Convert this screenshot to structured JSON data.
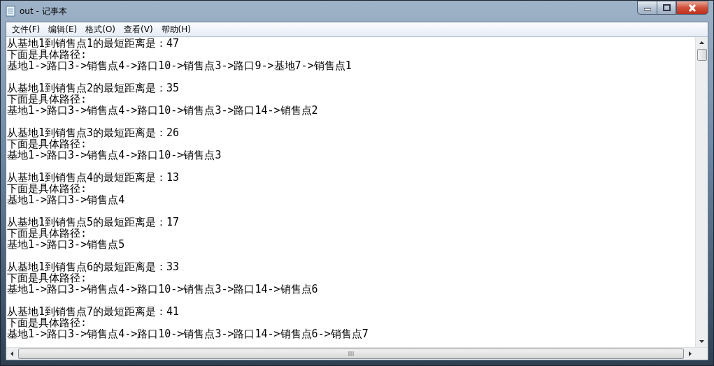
{
  "window": {
    "title": "out - 记事本"
  },
  "menu": [
    "文件(F)",
    "编辑(E)",
    "格式(O)",
    "查看(V)",
    "帮助(H)"
  ],
  "blocks": [
    {
      "heading": "从基地1到销售点1的最短距离是：47",
      "subheading": "下面是具体路径:",
      "path": "基地1->路口3->销售点4->路口10->销售点3->路口9->基地7->销售点1"
    },
    {
      "heading": "从基地1到销售点2的最短距离是：35",
      "subheading": "下面是具体路径:",
      "path": "基地1->路口3->销售点4->路口10->销售点3->路口14->销售点2"
    },
    {
      "heading": "从基地1到销售点3的最短距离是：26",
      "subheading": "下面是具体路径:",
      "path": "基地1->路口3->销售点4->路口10->销售点3"
    },
    {
      "heading": "从基地1到销售点4的最短距离是：13",
      "subheading": "下面是具体路径:",
      "path": "基地1->路口3->销售点4"
    },
    {
      "heading": "从基地1到销售点5的最短距离是：17",
      "subheading": "下面是具体路径:",
      "path": "基地1->路口3->销售点5"
    },
    {
      "heading": "从基地1到销售点6的最短距离是：33",
      "subheading": "下面是具体路径:",
      "path": "基地1->路口3->销售点4->路口10->销售点3->路口14->销售点6"
    },
    {
      "heading": "从基地1到销售点7的最短距离是：41",
      "subheading": "下面是具体路径:",
      "path": "基地1->路口3->销售点4->路口10->销售点3->路口14->销售点6->销售点7"
    }
  ]
}
